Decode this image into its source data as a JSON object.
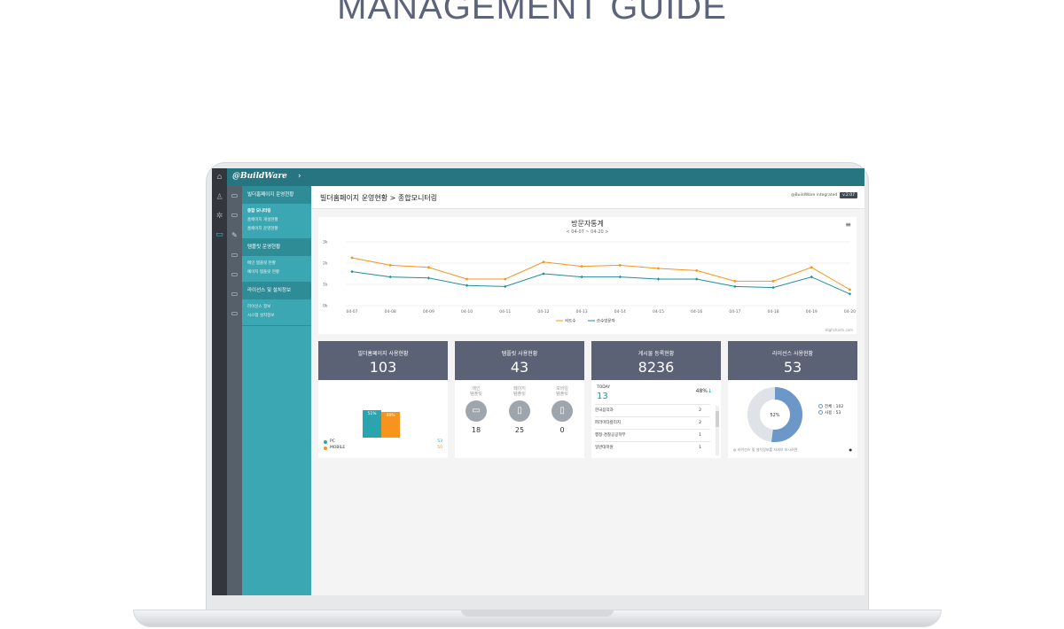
{
  "page_title": "MANAGEMENT GUIDE",
  "app": {
    "brand": "@BuildWare",
    "brand_arrow": "›",
    "breadcrumb": "빌더홈페이지 운영현황 > 종합모니터링",
    "brand_right": "@BuildWare integrated",
    "version": "v.2.07"
  },
  "sidebar": {
    "groups": [
      {
        "title": "빌더홈페이지 운영현황",
        "items": [
          "종합 모니터링",
          "홈페이지 개설현황",
          "홈페이지 운영현황"
        ]
      },
      {
        "title": "템플릿 운영현황",
        "items": [
          "메인 템플릿 현황",
          "페이지 템플릿 현황"
        ]
      },
      {
        "title": "라이선스 및 설치정보",
        "items": [
          "라이선스 정보",
          "시스템 설치정보"
        ]
      }
    ]
  },
  "chart_data": {
    "type": "line",
    "title": "방문자통계",
    "subtitle": "< 04-07 ~ 04-20 >",
    "categories": [
      "04-07",
      "04-08",
      "04-09",
      "04-10",
      "04-11",
      "04-12",
      "04-13",
      "04-14",
      "04-15",
      "04-16",
      "04-17",
      "04-18",
      "04-19",
      "04-20"
    ],
    "y_ticks": [
      "3k",
      "2k",
      "1k",
      "0k"
    ],
    "ylim": [
      0,
      3000
    ],
    "series": [
      {
        "name": "히트수",
        "color": "#f7941d",
        "values": [
          2250,
          1900,
          1800,
          1250,
          1250,
          2050,
          1850,
          1900,
          1750,
          1650,
          1150,
          1150,
          1800,
          750
        ]
      },
      {
        "name": "순수방문자",
        "color": "#1e8f9b",
        "values": [
          1600,
          1350,
          1300,
          950,
          900,
          1500,
          1350,
          1350,
          1250,
          1250,
          900,
          850,
          1350,
          550
        ]
      }
    ],
    "credit": "Highcharts.com"
  },
  "cards": {
    "homepage": {
      "label": "빌더홈페이지 사용현황",
      "value": "103",
      "bars": [
        {
          "label": "51%",
          "percent": 51,
          "color": "#2aa4af"
        },
        {
          "label": "49%",
          "percent": 49,
          "color": "#f7941d"
        }
      ],
      "legend": [
        {
          "name": "PC",
          "value": "53",
          "color": "#2aa4af"
        },
        {
          "name": "MOBILE",
          "value": "50",
          "color": "#f7941d"
        }
      ]
    },
    "template": {
      "label": "템플릿 사용현황",
      "value": "43",
      "cols": [
        {
          "label1": "메인",
          "label2": "템플릿",
          "count": "18"
        },
        {
          "label1": "페이지",
          "label2": "템플릿",
          "count": "25"
        },
        {
          "label1": "모바일",
          "label2": "템플릿",
          "count": "0"
        }
      ]
    },
    "board": {
      "label": "게시물 등록현황",
      "value": "8236",
      "today_label": "TODAY",
      "today_value": "13",
      "today_pct": "48%",
      "arrow": "↓",
      "rows": [
        {
          "name": "한국음악과",
          "count": "2"
        },
        {
          "name": "퍼라미타칼리지",
          "count": "2"
        },
        {
          "name": "행정·경찰공공학부",
          "count": "1"
        },
        {
          "name": "일반대학원",
          "count": "1"
        }
      ]
    },
    "license": {
      "label": "라이선스 사용현황",
      "value": "53",
      "donut_label": "52%",
      "percent": 52,
      "legend": [
        "전체 : 102",
        "사용 : 53"
      ],
      "note": "라이선스 및 설치정보를 자세히 보시려면",
      "note_dot": "●"
    }
  }
}
